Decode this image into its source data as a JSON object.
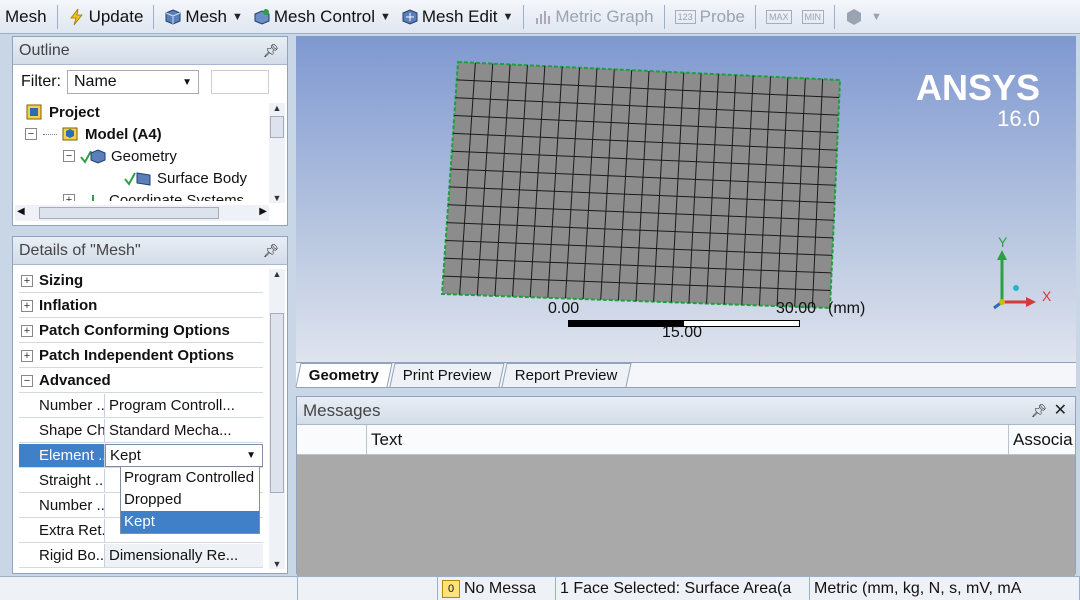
{
  "toolbar": {
    "mesh": "Mesh",
    "update": "Update",
    "mesh_menu": "Mesh",
    "mesh_control": "Mesh Control",
    "mesh_edit": "Mesh Edit",
    "metric_graph": "Metric Graph",
    "probe": "Probe",
    "max_label": "MAX",
    "min_label": "MIN",
    "probe_icon_label": "123"
  },
  "outline": {
    "title": "Outline",
    "filter_label": "Filter:",
    "filter_value": "Name",
    "tree": [
      {
        "label": "Project"
      },
      {
        "label": "Model (A4)"
      },
      {
        "label": "Geometry"
      },
      {
        "label": "Surface Body"
      },
      {
        "label": "Coordinate Systems"
      }
    ]
  },
  "details": {
    "title": "Details of \"Mesh\"",
    "groups": [
      "Sizing",
      "Inflation",
      "Patch Conforming Options",
      "Patch Independent Options",
      "Advanced"
    ],
    "props": [
      {
        "k": "Number ...",
        "v": "Program Controll..."
      },
      {
        "k": "Shape Ch...",
        "v": "Standard Mecha..."
      },
      {
        "k": "Element ...",
        "v": "Kept"
      },
      {
        "k": "Straight ...",
        "v": ""
      },
      {
        "k": "Number ...",
        "v": ""
      },
      {
        "k": "Extra Ret...",
        "v": ""
      },
      {
        "k": "Rigid Bo...",
        "v": "Dimensionally Re..."
      }
    ],
    "dropdown_options": [
      "Program Controlled",
      "Dropped",
      "Kept"
    ],
    "selected_option": "Kept"
  },
  "viewport": {
    "brand": "ANSYS",
    "version": "16.0",
    "scale_start": "0.00",
    "scale_mid": "15.00",
    "scale_end": "30.00",
    "scale_unit": "(mm)",
    "axis_y": "Y",
    "axis_x": "X"
  },
  "tabs": [
    "Geometry",
    "Print Preview",
    "Report Preview"
  ],
  "messages": {
    "title": "Messages",
    "col_text": "Text",
    "col_assoc": "Associa"
  },
  "statusbar": {
    "count": "0",
    "no_messages": "No Messa",
    "selection": "1 Face Selected: Surface Area(a",
    "units": "Metric (mm, kg, N, s, mV, mA"
  },
  "colors": {
    "accent": "#3f80c8",
    "mesh_fill": "#8c8c8c",
    "mesh_edge": "#1ea03a"
  }
}
